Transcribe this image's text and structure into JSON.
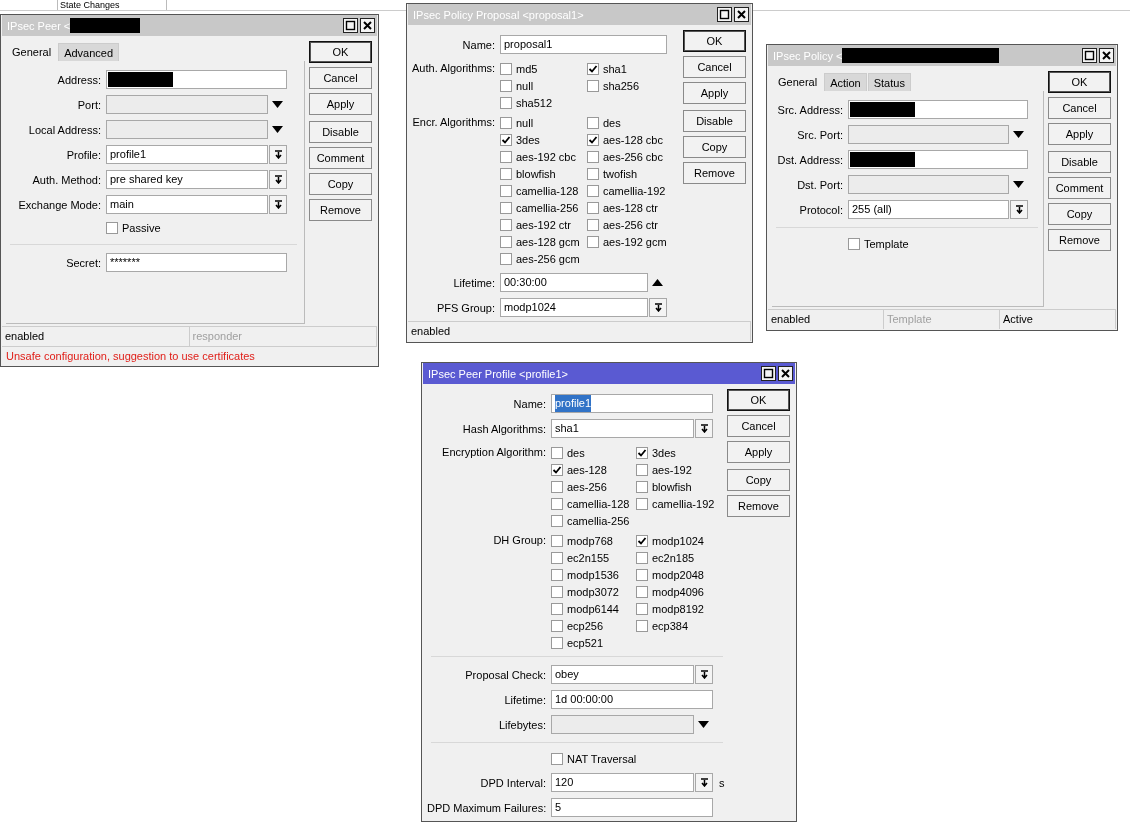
{
  "background_table": {
    "header": "State Changes"
  },
  "windows": [
    {
      "title": "IPsec Peer <",
      "title_redacted": true,
      "active": false,
      "tabs": [
        {
          "label": "General",
          "selected": true
        },
        {
          "label": "Advanced",
          "selected": false
        }
      ],
      "rows": [
        {
          "kind": "text",
          "label": "Address:",
          "redacted": true
        },
        {
          "kind": "dropdown",
          "label": "Port:"
        },
        {
          "kind": "dropdown",
          "label": "Local Address:"
        },
        {
          "kind": "combo",
          "label": "Profile:",
          "value": "profile1"
        },
        {
          "kind": "combo",
          "label": "Auth. Method:",
          "value": "pre shared key"
        },
        {
          "kind": "combo",
          "label": "Exchange Mode:",
          "value": "main"
        },
        {
          "kind": "check",
          "label": "Passive",
          "checked": false
        },
        {
          "kind": "separator"
        },
        {
          "kind": "text",
          "label": "Secret:",
          "value": "*******"
        }
      ],
      "button_groups": [
        [
          "OK",
          "Cancel",
          "Apply"
        ],
        [
          "Disable",
          "Comment",
          "Copy",
          "Remove"
        ]
      ],
      "status": [
        {
          "text": "enabled",
          "disabled": false
        },
        {
          "text": "responder",
          "disabled": true
        }
      ],
      "warning": "Unsafe configuration, suggestion to use certificates"
    },
    {
      "title": "IPsec Policy Proposal <proposal1>",
      "title_redacted": false,
      "active": false,
      "rows": [
        {
          "kind": "text",
          "label": "Name:",
          "value": "proposal1"
        },
        {
          "kind": "checks",
          "label": "Auth. Algorithms:",
          "options": [
            {
              "label": "md5",
              "checked": false
            },
            {
              "label": "sha1",
              "checked": true
            },
            {
              "label": "null",
              "checked": false
            },
            {
              "label": "sha256",
              "checked": false
            },
            {
              "label": "sha512",
              "checked": false
            }
          ]
        },
        {
          "kind": "checks",
          "label": "Encr. Algorithms:",
          "options": [
            {
              "label": "null",
              "checked": false
            },
            {
              "label": "des",
              "checked": false
            },
            {
              "label": "3des",
              "checked": true
            },
            {
              "label": "aes-128 cbc",
              "checked": true
            },
            {
              "label": "aes-192 cbc",
              "checked": false
            },
            {
              "label": "aes-256 cbc",
              "checked": false
            },
            {
              "label": "blowfish",
              "checked": false
            },
            {
              "label": "twofish",
              "checked": false
            },
            {
              "label": "camellia-128",
              "checked": false
            },
            {
              "label": "camellia-192",
              "checked": false
            },
            {
              "label": "camellia-256",
              "checked": false
            },
            {
              "label": "aes-128 ctr",
              "checked": false
            },
            {
              "label": "aes-192 ctr",
              "checked": false
            },
            {
              "label": "aes-256 ctr",
              "checked": false
            },
            {
              "label": "aes-128 gcm",
              "checked": false
            },
            {
              "label": "aes-192 gcm",
              "checked": false
            },
            {
              "label": "aes-256 gcm",
              "checked": false
            }
          ]
        },
        {
          "kind": "spin",
          "label": "Lifetime:",
          "value": "00:30:00"
        },
        {
          "kind": "combo",
          "label": "PFS Group:",
          "value": "modp1024"
        }
      ],
      "button_groups": [
        [
          "OK",
          "Cancel",
          "Apply"
        ],
        [
          "Disable",
          "Copy",
          "Remove"
        ]
      ],
      "status": [
        {
          "text": "enabled",
          "disabled": false
        }
      ]
    },
    {
      "title": "IPsec Policy <",
      "title_redacted": true,
      "active": false,
      "tabs": [
        {
          "label": "General",
          "selected": true
        },
        {
          "label": "Action",
          "selected": false
        },
        {
          "label": "Status",
          "selected": false
        }
      ],
      "rows": [
        {
          "kind": "text",
          "label": "Src. Address:",
          "redacted": true
        },
        {
          "kind": "dropdown",
          "label": "Src. Port:"
        },
        {
          "kind": "text",
          "label": "Dst. Address:",
          "redacted": true
        },
        {
          "kind": "dropdown",
          "label": "Dst. Port:"
        },
        {
          "kind": "combo",
          "label": "Protocol:",
          "value": "255 (all)"
        },
        {
          "kind": "separator"
        },
        {
          "kind": "check",
          "label": "Template",
          "checked": false
        }
      ],
      "button_groups": [
        [
          "OK",
          "Cancel",
          "Apply"
        ],
        [
          "Disable",
          "Comment",
          "Copy",
          "Remove"
        ]
      ],
      "status": [
        {
          "text": "enabled",
          "disabled": false
        },
        {
          "text": "Template",
          "disabled": true
        },
        {
          "text": "Active",
          "disabled": false
        }
      ]
    },
    {
      "title": "IPsec Peer Profile <profile1>",
      "title_redacted": false,
      "active": true,
      "rows": [
        {
          "kind": "text",
          "label": "Name:",
          "value": "profile1",
          "selected": true
        },
        {
          "kind": "combo",
          "label": "Hash Algorithms:",
          "value": "sha1"
        },
        {
          "kind": "checks",
          "label": "Encryption Algorithm:",
          "options": [
            {
              "label": "des",
              "checked": false
            },
            {
              "label": "3des",
              "checked": true
            },
            {
              "label": "aes-128",
              "checked": true
            },
            {
              "label": "aes-192",
              "checked": false
            },
            {
              "label": "aes-256",
              "checked": false
            },
            {
              "label": "blowfish",
              "checked": false
            },
            {
              "label": "camellia-128",
              "checked": false
            },
            {
              "label": "camellia-192",
              "checked": false
            },
            {
              "label": "camellia-256",
              "checked": false
            }
          ]
        },
        {
          "kind": "checks",
          "label": "DH Group:",
          "options": [
            {
              "label": "modp768",
              "checked": false
            },
            {
              "label": "modp1024",
              "checked": true
            },
            {
              "label": "ec2n155",
              "checked": false
            },
            {
              "label": "ec2n185",
              "checked": false
            },
            {
              "label": "modp1536",
              "checked": false
            },
            {
              "label": "modp2048",
              "checked": false
            },
            {
              "label": "modp3072",
              "checked": false
            },
            {
              "label": "modp4096",
              "checked": false
            },
            {
              "label": "modp6144",
              "checked": false
            },
            {
              "label": "modp8192",
              "checked": false
            },
            {
              "label": "ecp256",
              "checked": false
            },
            {
              "label": "ecp384",
              "checked": false
            },
            {
              "label": "ecp521",
              "checked": false
            }
          ]
        },
        {
          "kind": "separator"
        },
        {
          "kind": "combo",
          "label": "Proposal Check:",
          "value": "obey"
        },
        {
          "kind": "text",
          "label": "Lifetime:",
          "value": "1d 00:00:00"
        },
        {
          "kind": "dropdown",
          "label": "Lifebytes:"
        },
        {
          "kind": "separator"
        },
        {
          "kind": "check",
          "label": "NAT Traversal",
          "checked": false
        },
        {
          "kind": "combo",
          "label": "DPD Interval:",
          "value": "120",
          "unit": "s"
        },
        {
          "kind": "text",
          "label": "DPD Maximum Failures:",
          "value": "5"
        }
      ],
      "button_groups": [
        [
          "OK",
          "Cancel",
          "Apply"
        ],
        [
          "Copy",
          "Remove"
        ]
      ]
    }
  ]
}
